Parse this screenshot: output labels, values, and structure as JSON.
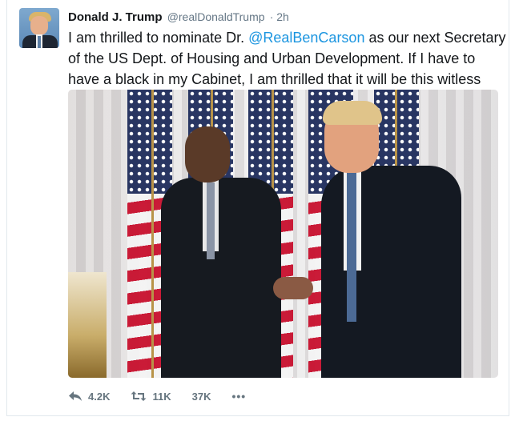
{
  "tweet": {
    "author_name": "Donald J. Trump",
    "handle": "@realDonaldTrump",
    "time": "· 2h",
    "text_parts": {
      "before": "I am thrilled to nominate Dr. ",
      "mention": "@RealBenCarson",
      "after": " as our next Secretary of the US Dept. of Housing and Urban Development. If I have to have a black in my Cabinet, I am thrilled that it will be this witless moron."
    }
  },
  "actions": {
    "reply_count": "4.2K",
    "retweet_count": "11K",
    "like_count": "37K",
    "more_label": "•••"
  },
  "colors": {
    "link": "#1b95e0",
    "meta": "#657786",
    "action": "#66757f"
  }
}
